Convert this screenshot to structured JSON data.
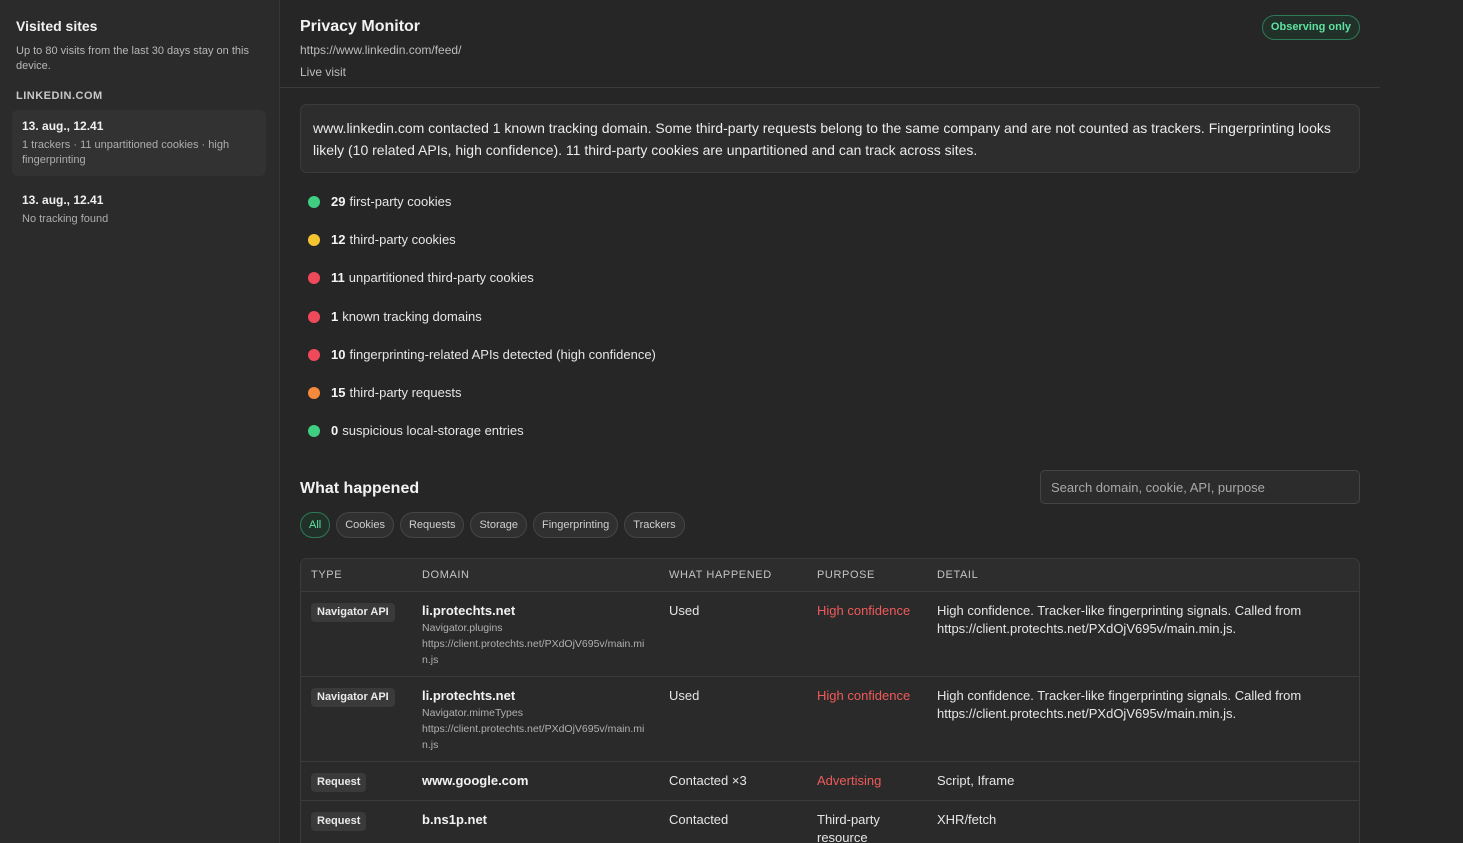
{
  "sidebar": {
    "title": "Visited sites",
    "subtitle": "Up to 80 visits from the last 30 days stay on this device.",
    "group_label": "LINKEDIN.COM",
    "visits": [
      {
        "title": "13. aug., 12.41",
        "summary": "1 trackers · 11 unpartitioned cookies · high fingerprinting"
      },
      {
        "title": "13. aug., 12.41",
        "summary": "No tracking found"
      }
    ]
  },
  "header": {
    "title": "Privacy Monitor",
    "url": "https://www.linkedin.com/feed/",
    "status": "Live visit",
    "badge": "Observing only"
  },
  "summary_text": "www.linkedin.com contacted 1 known tracking domain. Some third-party requests belong to the same company and are not counted as trackers. Fingerprinting looks likely (10 related APIs, high confidence). 11 third-party cookies are unpartitioned and can track across sites.",
  "stats": [
    {
      "count": "29",
      "label": "first-party cookies",
      "color": "#3ecf82"
    },
    {
      "count": "12",
      "label": "third-party cookies",
      "color": "#f4c430"
    },
    {
      "count": "11",
      "label": "unpartitioned third-party cookies",
      "color": "#ef4a5a"
    },
    {
      "count": "1",
      "label": "known tracking domains",
      "color": "#ef4a5a"
    },
    {
      "count": "10",
      "label": "fingerprinting-related APIs detected (high confidence)",
      "color": "#ef4a5a"
    },
    {
      "count": "15",
      "label": "third-party requests",
      "color": "#f58a3c"
    },
    {
      "count": "0",
      "label": "suspicious local-storage entries",
      "color": "#3ecf82"
    }
  ],
  "events": {
    "title": "What happened",
    "search_placeholder": "Search domain, cookie, API, purpose",
    "filters": [
      "All",
      "Cookies",
      "Requests",
      "Storage",
      "Fingerprinting",
      "Trackers"
    ],
    "columns": [
      "TYPE",
      "DOMAIN",
      "WHAT HAPPENED",
      "PURPOSE",
      "DETAIL"
    ],
    "rows": [
      {
        "type": "Navigator API",
        "domain": "li.protechts.net",
        "sub1": "Navigator.plugins",
        "sub2": "https://client.protechts.net/PXdOjV695v/main.min.js",
        "what": "Used",
        "purpose": "High confidence",
        "purpose_color": "#ef5a5a",
        "detail": "High confidence. Tracker-like fingerprinting signals. Called from https://client.protechts.net/PXdOjV695v/main.min.js."
      },
      {
        "type": "Navigator API",
        "domain": "li.protechts.net",
        "sub1": "Navigator.mimeTypes",
        "sub2": "https://client.protechts.net/PXdOjV695v/main.min.js",
        "what": "Used",
        "purpose": "High confidence",
        "purpose_color": "#ef5a5a",
        "detail": "High confidence. Tracker-like fingerprinting signals. Called from https://client.protechts.net/PXdOjV695v/main.min.js."
      },
      {
        "type": "Request",
        "domain": "www.google.com",
        "sub1": "",
        "sub2": "",
        "what": "Contacted ×3",
        "purpose": "Advertising",
        "purpose_color": "#ef5a5a",
        "detail": "Script, Iframe"
      },
      {
        "type": "Request",
        "domain": "b.ns1p.net",
        "sub1": "",
        "sub2": "",
        "what": "Contacted",
        "purpose": "Third-party resource",
        "purpose_color": "#e6e6e6",
        "detail": "XHR/fetch"
      }
    ]
  }
}
